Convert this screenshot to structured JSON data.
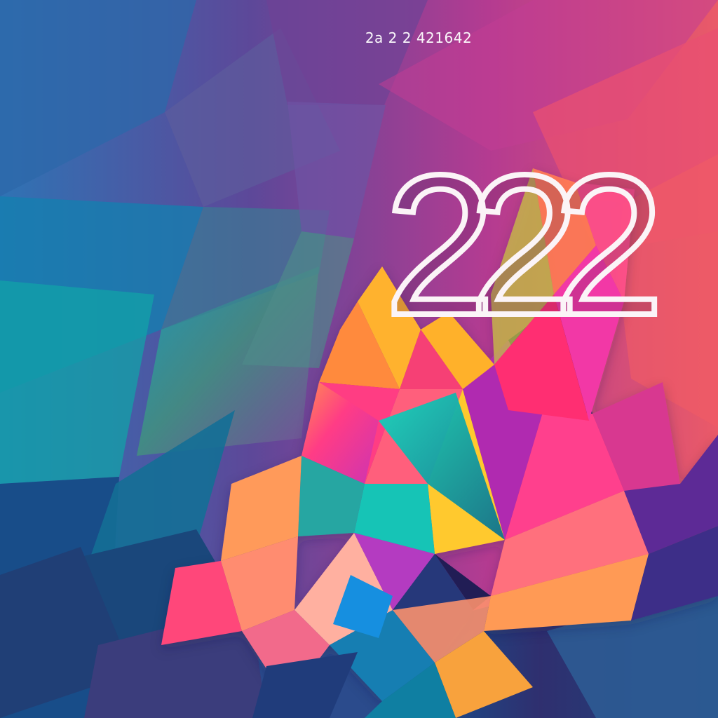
{
  "page": {
    "caption": "2a 2 2 421642",
    "headline": "222"
  },
  "colors": {
    "background_left": "#2f6fae",
    "background_middle": "#6b4596",
    "background_right": "#e8536c",
    "accent_pink": "#ff3d86",
    "accent_orange": "#ff8a3d",
    "accent_teal": "#17c6b8",
    "accent_yellow": "#f7cb3f",
    "accent_navy": "#20275c",
    "text": "#fbf4f7"
  },
  "visual_elements": {
    "background_style": "low-poly geometric gradient",
    "foreground_motif": "abstract multicolor polygon mountain"
  }
}
